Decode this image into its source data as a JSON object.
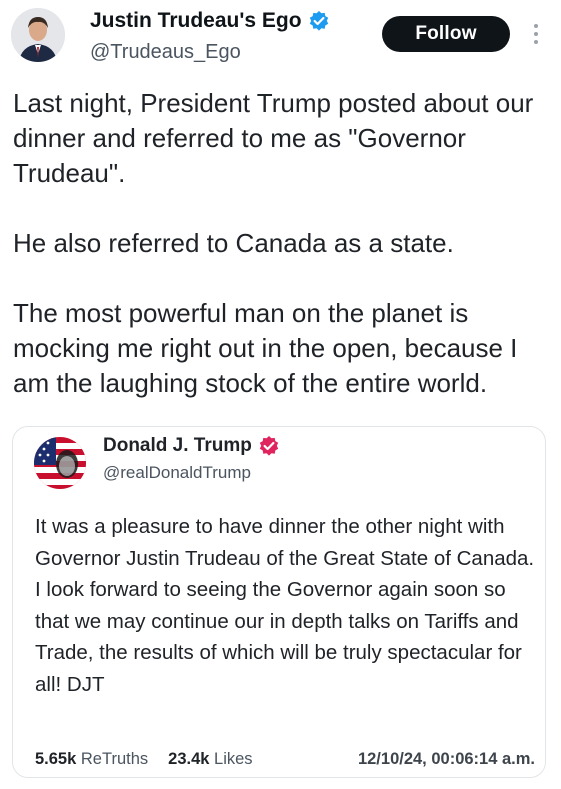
{
  "author": {
    "display_name": "Justin Trudeau's Ego",
    "handle": "@Trudeaus_Ego",
    "verified_color": "#1d9bf0"
  },
  "follow_label": "Follow",
  "tweet_text": "Last night, President Trump posted about our dinner and referred to me as \"Governor Trudeau\".\n\nHe also referred to Canada as a state.\n\nThe most powerful man on the planet is mocking me right out in the open, because I am the laughing stock of the entire world.",
  "quoted": {
    "display_name": "Donald J. Trump",
    "handle": "@realDonaldTrump",
    "badge_color": "#e0245e",
    "text": "It was a pleasure to have dinner the other night with Governor Justin Trudeau of the Great State of Canada. I look forward to seeing the Governor again soon so that we may continue our in depth talks on Tariffs and Trade, the results of which will be truly spectacular for all! DJT",
    "retruths_count": "5.65k",
    "retruths_label": "ReTruths",
    "likes_count": "23.4k",
    "likes_label": "Likes",
    "timestamp": "12/10/24, 00:06:14 a.m."
  }
}
